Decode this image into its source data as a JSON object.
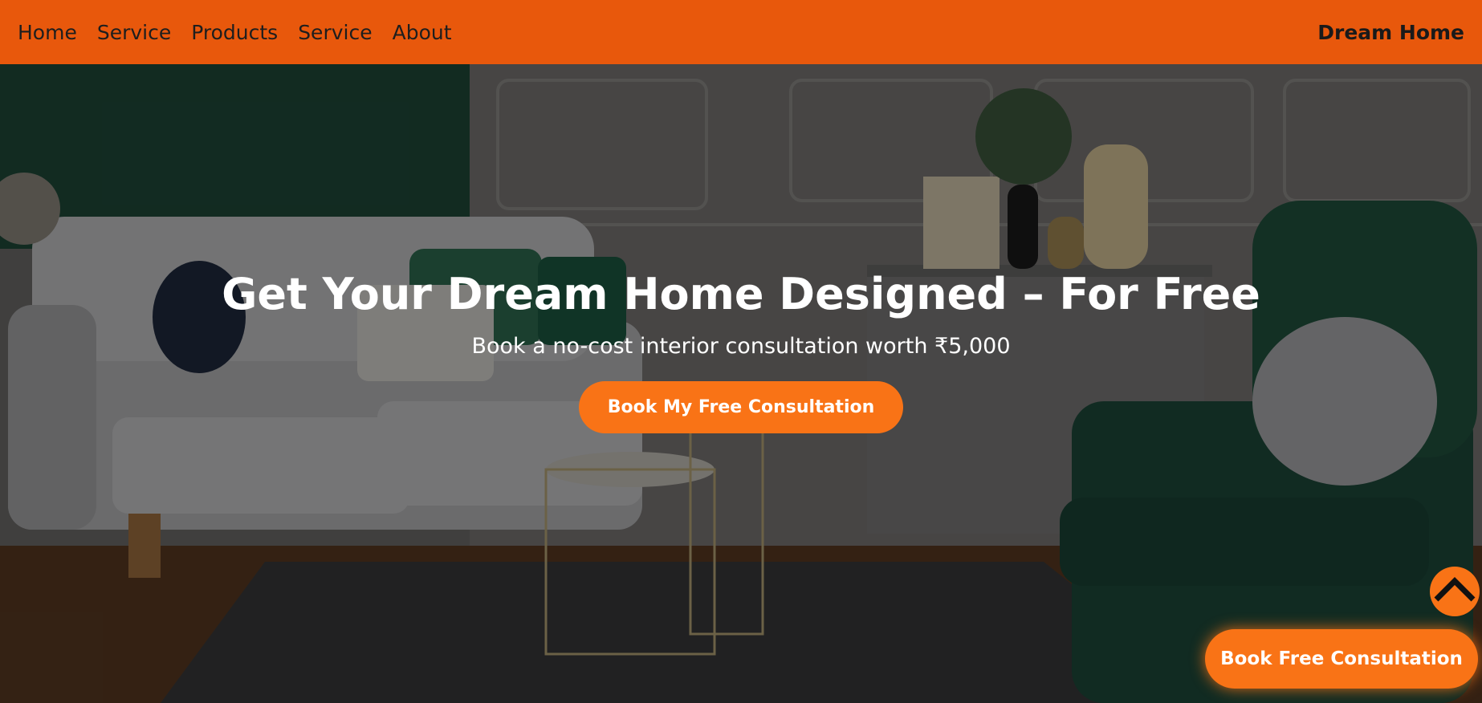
{
  "nav": {
    "links": [
      "Home",
      "Service",
      "Products",
      "Service",
      "About"
    ],
    "brand": "Dream Home"
  },
  "hero": {
    "title": "Get Your Dream Home Designed – For Free",
    "subtitle": "Book a no-cost interior consultation worth ₹5,000",
    "cta_label": "Book My Free Consultation",
    "background_image": "living-room-interior"
  },
  "floating": {
    "scroll_top_icon": "chevron-up-icon",
    "cta_label": "Book Free Consultation"
  },
  "colors": {
    "nav_bg": "#e8580c",
    "accent": "#f97316"
  }
}
